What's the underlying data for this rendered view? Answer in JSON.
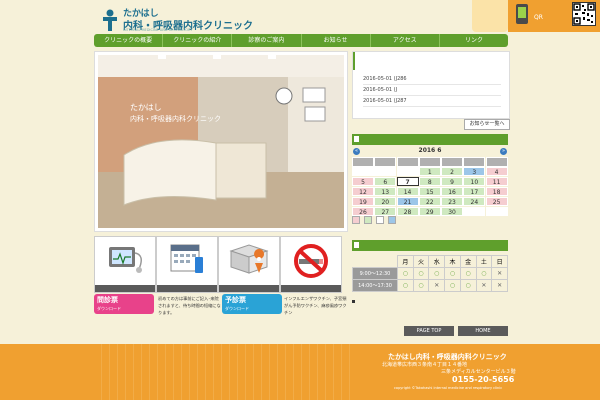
{
  "header": {
    "logo_line1": "たかはし",
    "logo_line2": "内科・呼吸器内科クリニック",
    "logo_en": "INTERNAL MEDICINE AND RESPIRATORY",
    "qr_label": "QR"
  },
  "nav": [
    "クリニックの概要",
    "クリニックの紹介",
    "診察のご案内",
    "お知らせ",
    "アクセス",
    "リンク"
  ],
  "photo": {
    "sign_line1": "たかはし",
    "sign_line2": "内科・呼吸器内科クリニック"
  },
  "news": {
    "items": [
      "2016-05-01 (J286",
      "2016-05-01 (J",
      "2016-05-01 (J287"
    ],
    "more_label": "お知らせ一覧へ"
  },
  "calendar": {
    "title": "2016 6",
    "prev": "«",
    "next": "»",
    "rows": [
      [
        "",
        "",
        "",
        "1",
        "2",
        "3",
        "4"
      ],
      [
        "5",
        "6",
        "7",
        "8",
        "9",
        "10",
        "11"
      ],
      [
        "12",
        "13",
        "14",
        "15",
        "16",
        "17",
        "18"
      ],
      [
        "19",
        "20",
        "21",
        "22",
        "23",
        "24",
        "25"
      ],
      [
        "26",
        "27",
        "28",
        "29",
        "30",
        "",
        ""
      ]
    ]
  },
  "schedule": {
    "days": [
      "月",
      "火",
      "水",
      "木",
      "金",
      "土",
      "日"
    ],
    "rows": [
      {
        "time": "9:00〜12:30",
        "marks": [
          "○",
          "○",
          "○",
          "○",
          "○",
          "○",
          "✕"
        ]
      },
      {
        "time": "14:00〜17:30",
        "marks": [
          "○",
          "○",
          "✕",
          "○",
          "○",
          "✕",
          "✕"
        ]
      }
    ]
  },
  "downloads": [
    {
      "title": "問診票",
      "sub": "ダウンロード",
      "desc": "初めての方は事前にご記入･来院されますと、待ち時間の短縮になります。"
    },
    {
      "title": "予診票",
      "sub": "ダウンロード",
      "desc": "インフルエンザワクチン、子宮頸がん予防ワクチン、麻疹風疹ワクチン"
    }
  ],
  "page_top_label": "PAGE TOP",
  "home_label": "HOME",
  "footer": {
    "name": "たかはし内科・呼吸器内科クリニック",
    "address1": "北海道帯広市西３条南４丁目１４番地",
    "address2": "三条メディカルセンタービル３階",
    "tel": "0155-20-5656",
    "copyright": "copyright ©Takahashi internal medicine and respiratory clinic"
  },
  "colors": {
    "nav_green": "#5f9f2c",
    "footer_orange": "#f0a030",
    "download_pink": "#e8428a",
    "download_blue": "#2aa3d6"
  }
}
